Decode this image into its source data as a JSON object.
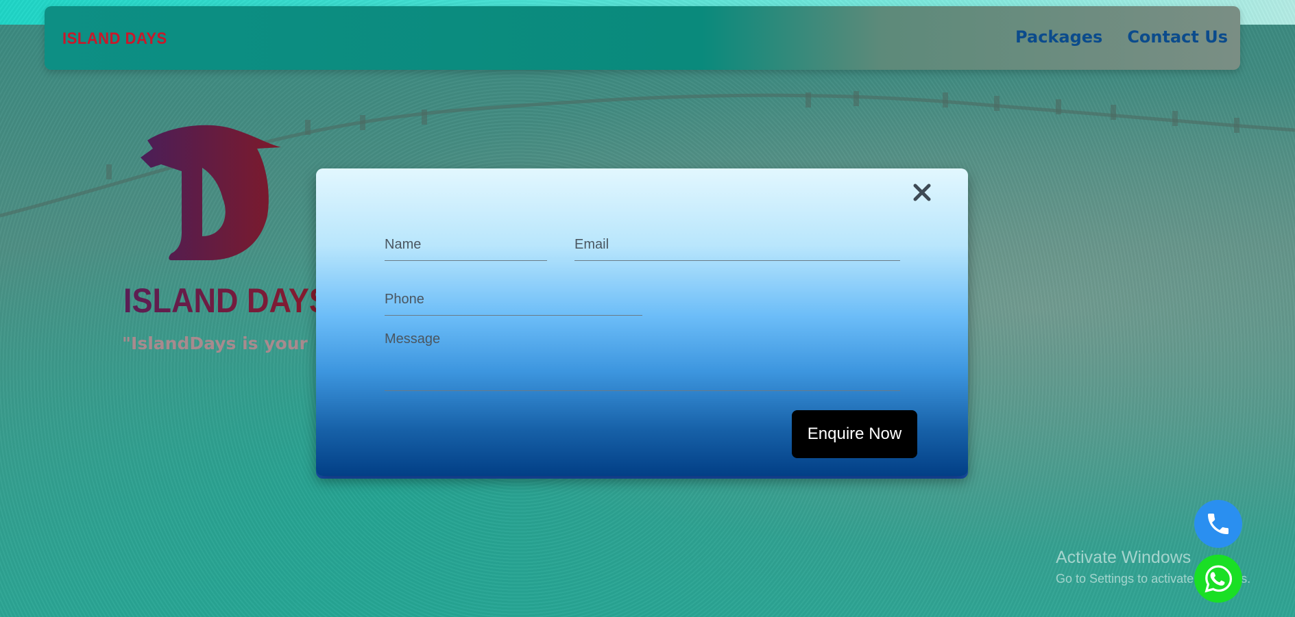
{
  "navbar": {
    "brand": "ISLAND DAYS",
    "links": [
      "Packages",
      "Contact Us"
    ]
  },
  "hero": {
    "title": "ISLAND DAYS",
    "tagline": "\"IslandDays is your"
  },
  "modal": {
    "name_placeholder": "Name",
    "email_placeholder": "Email",
    "phone_placeholder": "Phone",
    "message_placeholder": "Message",
    "submit_label": "Enquire Now"
  },
  "watermark": {
    "title": "Activate Windows",
    "subtitle": "Go to Settings to activate Windows."
  },
  "icons": {
    "close": "close-icon",
    "phone": "phone-icon",
    "whatsapp": "whatsapp-icon"
  },
  "colors": {
    "brand_red": "#c8182a",
    "nav_link": "#0b4b8c",
    "phone_fab": "#2a8ff0",
    "whatsapp_fab": "#1adf25",
    "button_bg": "#000000"
  }
}
